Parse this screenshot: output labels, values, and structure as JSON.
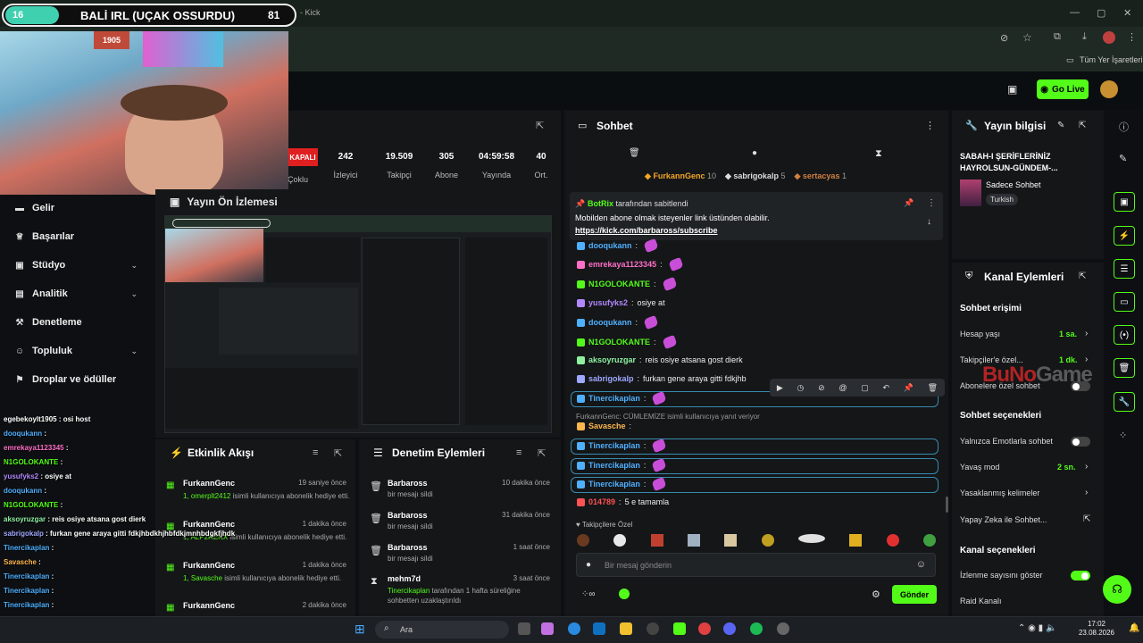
{
  "overlay": {
    "left_num": "16",
    "title": "BALİ IRL (UÇAK OSSURDU)",
    "right_num": "81"
  },
  "browser": {
    "tab_fragment": "- Kick",
    "bookmarks_label": "Tüm Yer İşaretleri"
  },
  "header": {
    "go_live_label": "Go Live"
  },
  "sidebar": {
    "items": [
      {
        "label": "Gelir",
        "icon": "revenue-icon"
      },
      {
        "label": "Başarılar",
        "icon": "trophy-icon"
      },
      {
        "label": "Stüdyo",
        "icon": "studio-icon"
      },
      {
        "label": "Analitik",
        "icon": "analytics-icon"
      },
      {
        "label": "Denetleme",
        "icon": "hammer-icon"
      },
      {
        "label": "Topluluk",
        "icon": "community-icon"
      },
      {
        "label": "Droplar ve ödüller",
        "icon": "gift-icon"
      }
    ]
  },
  "stats": {
    "status": "KAPALI",
    "status_sub": "Çoklu",
    "items": [
      {
        "value": "242",
        "label": "İzleyici"
      },
      {
        "value": "19.509",
        "label": "Takipçi"
      },
      {
        "value": "305",
        "label": "Abone"
      },
      {
        "value": "04:59:58",
        "label": "Yayında"
      },
      {
        "value": "40",
        "label": "Ort."
      }
    ]
  },
  "preview": {
    "title": "Yayın Ön İzlemesi"
  },
  "activity": {
    "title": "Etkinlik Akışı",
    "items": [
      {
        "name": "FurkannGenc",
        "time": "19 saniye önce",
        "user": "1, omerplt2412",
        "text": "isimli kullanıcıya abonelik hediye etti."
      },
      {
        "name": "FurkannGenc",
        "time": "1 dakika önce",
        "user": "1, ALP2RENX",
        "text": "isimli kullanıcıya abonelik hediye etti."
      },
      {
        "name": "FurkannGenc",
        "time": "1 dakika önce",
        "user": "1, Savasche",
        "text": "isimli kullanıcıya abonelik hediye etti."
      },
      {
        "name": "FurkannGenc",
        "time": "2 dakika önce",
        "user": "",
        "text": ""
      }
    ]
  },
  "moderation": {
    "title": "Denetim Eylemleri",
    "items": [
      {
        "name": "Barbaross",
        "time": "10 dakika önce",
        "text": "bir mesajı sildi"
      },
      {
        "name": "Barbaross",
        "time": "31 dakika önce",
        "text": "bir mesajı sildi"
      },
      {
        "name": "Barbaross",
        "time": "1 saat önce",
        "text": "bir mesajı sildi"
      },
      {
        "name": "mehm7d",
        "time": "3 saat önce",
        "user": "Tinercikaplan",
        "text": "tarafından 1 hafta süreliğine sohbetten uzaklaştırıldı"
      }
    ]
  },
  "chat": {
    "title": "Sohbet",
    "top_gifters": [
      {
        "name": "FurkannGenc",
        "count": "10"
      },
      {
        "name": "sabrigokalp",
        "count": "5"
      },
      {
        "name": "sertacyas",
        "count": "1"
      }
    ],
    "pinned": {
      "pinner": "BotRix",
      "pinned_label": "tarafından sabitlendi",
      "text": "Mobilden abone olmak isteyenler link üstünden olabilir.",
      "link": "https://kick.com/barbaross/subscribe"
    },
    "messages": [
      {
        "user": "dooqukann",
        "color": "#4fb0ff",
        "text": "",
        "emote": true
      },
      {
        "user": "emrekaya1123345",
        "color": "#ff6ec7",
        "text": "",
        "emote": true
      },
      {
        "user": "N1GOLOKANTE",
        "color": "#53fc18",
        "text": "",
        "emote": true
      },
      {
        "user": "yusufyks2",
        "color": "#b388ff",
        "text": "osiye at",
        "emote": false
      },
      {
        "user": "dooqukann",
        "color": "#4fb0ff",
        "text": "",
        "emote": true
      },
      {
        "user": "N1GOLOKANTE",
        "color": "#53fc18",
        "text": "",
        "emote": true
      },
      {
        "user": "aksoyruzgar",
        "color": "#8ef0a0",
        "text": "reis osiye atsana gost dierk",
        "emote": false
      },
      {
        "user": "sabrigokalp",
        "color": "#9fa8ff",
        "text": "furkan gene araya gitti fdkjhb",
        "emote": false
      },
      {
        "user": "Tinercikaplan",
        "color": "#4fb0ff",
        "text": "",
        "emote": true
      },
      {
        "user": "Savasche",
        "color": "#ffb74d",
        "text": "",
        "emote": false
      },
      {
        "user": "Tinercikaplan",
        "color": "#4fb0ff",
        "text": "",
        "emote": true
      },
      {
        "user": "Tinercikaplan",
        "color": "#4fb0ff",
        "text": "",
        "emote": true
      },
      {
        "user": "Tinercikaplan",
        "color": "#4fb0ff",
        "text": "",
        "emote": true
      },
      {
        "user": "014789",
        "color": "#ff5252",
        "text": "5 e tamamla",
        "emote": false
      }
    ],
    "reply_note": "FurkannGenc: CÜMLEMİZE isimli kullanıcıya yanıt veriyor",
    "followers_only": "Takipçilere Özel",
    "input_placeholder": "Bir mesaj gönderin",
    "send_label": "Gönder"
  },
  "stream_info": {
    "title": "Yayın bilgisi",
    "stream_title": "SABAH-I ŞERİFLERİNİZ HAYROLSUN-GÜNDEM-...",
    "category": "Sadece Sohbet",
    "tag": "Turkish"
  },
  "channel_actions": {
    "title": "Kanal Eylemleri",
    "chat_access": "Sohbet erişimi",
    "account_age": {
      "label": "Hesap yaşı",
      "value": "1 sa."
    },
    "followers": {
      "label": "Takipçiler'e özel...",
      "value": "1 dk."
    },
    "subs_only": "Abonelere özel sohbet",
    "chat_options": "Sohbet seçenekleri",
    "emote_only": "Yalnızca Emotlarla sohbet",
    "slow_mode": {
      "label": "Yavaş mod",
      "value": "2 sn."
    },
    "banned_words": "Yasaklanmış kelimeler",
    "ai_chat": "Yapay Zeka ile Sohbet...",
    "channel_options": "Kanal seçenekleri",
    "show_viewers": "İzlenme sayısını göster",
    "raid": "Raid Kanalı"
  },
  "overlay_chat": [
    {
      "user": "egebekoylt1905",
      "text": "osi host",
      "color": "#fff"
    },
    {
      "user": "dooqukann",
      "text": "",
      "color": "#4fb0ff"
    },
    {
      "user": "emrekaya1123345",
      "text": "",
      "color": "#ff6ec7"
    },
    {
      "user": "N1GOLOKANTE",
      "text": "",
      "color": "#53fc18"
    },
    {
      "user": "yusufyks2",
      "text": "osiye at",
      "color": "#b388ff"
    },
    {
      "user": "dooqukann",
      "text": "",
      "color": "#4fb0ff"
    },
    {
      "user": "N1GOLOKANTE",
      "text": "",
      "color": "#53fc18"
    },
    {
      "user": "aksoyruzgar",
      "text": "reis osiye atsana gost dierk",
      "color": "#8ef0a0"
    },
    {
      "user": "sabrigokalp",
      "text": "furkan gene araya gitti fdkjhbdkhjhbfdkjmnhbdgkfjhdk",
      "color": "#9fa8ff"
    },
    {
      "user": "Tinercikaplan",
      "text": "",
      "color": "#4fb0ff"
    },
    {
      "user": "Savasche",
      "text": "",
      "color": "#ffb74d"
    },
    {
      "user": "Tinercikaplan",
      "text": "",
      "color": "#4fb0ff"
    },
    {
      "user": "Tinercikaplan",
      "text": "",
      "color": "#4fb0ff"
    },
    {
      "user": "Tinercikaplan",
      "text": "",
      "color": "#4fb0ff"
    },
    {
      "user": "014789",
      "text": "5 e tamamla",
      "color": "#ff5252"
    }
  ],
  "watermark": {
    "part1": "BuNo",
    "part2": "Game"
  },
  "taskbar": {
    "search": "Ara",
    "time": "17:02",
    "date": "23.08.2026"
  },
  "colors": {
    "accent": "#53fc18",
    "bg": "#0d0f12",
    "panel": "#141618"
  }
}
